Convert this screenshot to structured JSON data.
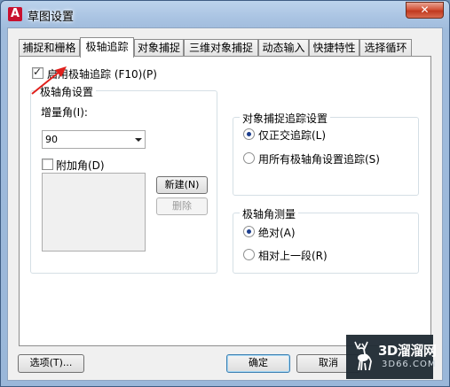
{
  "window": {
    "app_icon_letter": "A",
    "title": "草图设置",
    "close_glyph": "✕"
  },
  "tabs": [
    {
      "label": "捕捉和栅格",
      "active": false
    },
    {
      "label": "极轴追踪",
      "active": true
    },
    {
      "label": "对象捕捉",
      "active": false
    },
    {
      "label": "三维对象捕捉",
      "active": false
    },
    {
      "label": "动态输入",
      "active": false
    },
    {
      "label": "快捷特性",
      "active": false
    },
    {
      "label": "选择循环",
      "active": false
    }
  ],
  "polar": {
    "enable_label": "启用极轴追踪 (F10)(P)",
    "enable_checked": true,
    "settings_group_title": "极轴角设置",
    "increment_label": "增量角(I):",
    "increment_value": "90",
    "additional_label": "附加角(D)",
    "additional_checked": false,
    "new_button": "新建(N)",
    "delete_button": "删除"
  },
  "osnap_tracking": {
    "group_title": "对象捕捉追踪设置",
    "orthogonal_label": "仅正交追踪(L)",
    "orthogonal_selected": true,
    "all_polar_label": "用所有极轴角设置追踪(S)",
    "all_polar_selected": false
  },
  "measurement": {
    "group_title": "极轴角测量",
    "absolute_label": "绝对(A)",
    "absolute_selected": true,
    "relative_label": "相对上一段(R)",
    "relative_selected": false
  },
  "footer": {
    "options_button": "选项(T)...",
    "ok_button": "确定",
    "cancel_button": "取消"
  },
  "watermark": {
    "brand": "3D溜溜网",
    "domain": "3D66.COM"
  },
  "colors": {
    "annotation_arrow": "#e0201c",
    "close_button": "#c8452a",
    "app_icon": "#c8102e"
  }
}
